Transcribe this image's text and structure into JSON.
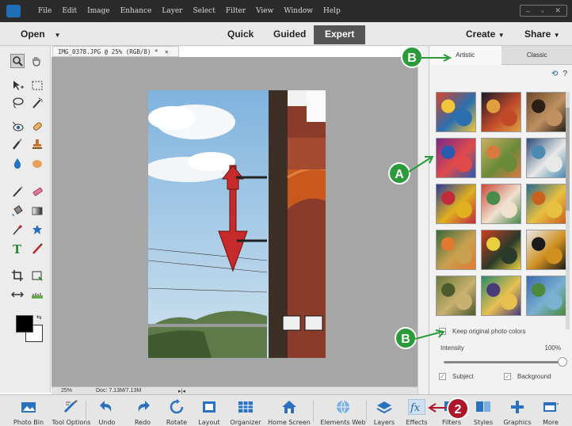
{
  "colors": {
    "callout_green": "#2a9a3a",
    "callout_red": "#b0162a",
    "menubar": "#2b2b2b",
    "accent_blue": "#1a5fa0"
  },
  "menubar": {
    "items": [
      "File",
      "Edit",
      "Image",
      "Enhance",
      "Layer",
      "Select",
      "Filter",
      "View",
      "Window",
      "Help"
    ]
  },
  "modebar": {
    "open": "Open",
    "modes": [
      "Quick",
      "Guided",
      "Expert"
    ],
    "active_mode": "Expert",
    "create": "Create",
    "share": "Share"
  },
  "document": {
    "tab_title": "IMG_0378.JPG @ 25% (RGB/8) *",
    "close": "×",
    "zoom": "25%",
    "doc_size": "Doc: 7.13M/7.13M"
  },
  "tools": [
    "zoom-icon",
    "hand-icon",
    "move-icon",
    "marquee-icon",
    "lasso-icon",
    "quick-selection-icon",
    "red-eye-icon",
    "spot-healing-icon",
    "smart-brush-icon",
    "clone-stamp-icon",
    "blur-icon",
    "sponge-icon",
    "brush-icon",
    "eraser-icon",
    "paint-bucket-icon",
    "gradient-icon",
    "eyedropper-icon",
    "custom-shape-icon",
    "type-icon",
    "pencil-icon",
    "crop-icon",
    "recompose-icon",
    "content-aware-move-icon",
    "straighten-icon"
  ],
  "effects_panel": {
    "tabs": [
      "Artistic",
      "Classic"
    ],
    "active_tab": "Artistic",
    "thumbnail_count": 15,
    "keep_colors_label": "Keep original photo colors",
    "intensity_label": "Intensity",
    "intensity_value": "100%",
    "intensity_level": 1.0,
    "subject_label": "Subject",
    "background_label": "Background"
  },
  "taskbar": {
    "items": [
      {
        "label": "Photo Bin",
        "icon": "photo-bin-icon"
      },
      {
        "label": "Tool Options",
        "icon": "tool-options-icon"
      },
      {
        "label": "Undo",
        "icon": "undo-icon"
      },
      {
        "label": "Redo",
        "icon": "redo-icon"
      },
      {
        "label": "Rotate",
        "icon": "rotate-icon"
      },
      {
        "label": "Layout",
        "icon": "layout-icon"
      },
      {
        "label": "Organizer",
        "icon": "organizer-icon"
      },
      {
        "label": "Home Screen",
        "icon": "home-icon"
      },
      {
        "label": "Elements Web",
        "icon": "globe-icon"
      },
      {
        "label": "Layers",
        "icon": "layers-icon"
      },
      {
        "label": "Effects",
        "icon": "fx-icon"
      },
      {
        "label": "Filters",
        "icon": "filters-icon"
      },
      {
        "label": "Styles",
        "icon": "styles-icon"
      },
      {
        "label": "Graphics",
        "icon": "graphics-icon"
      },
      {
        "label": "More",
        "icon": "more-icon"
      }
    ]
  },
  "callouts": {
    "a": "A",
    "b_top": "B",
    "b_bottom": "B",
    "two": "2"
  }
}
